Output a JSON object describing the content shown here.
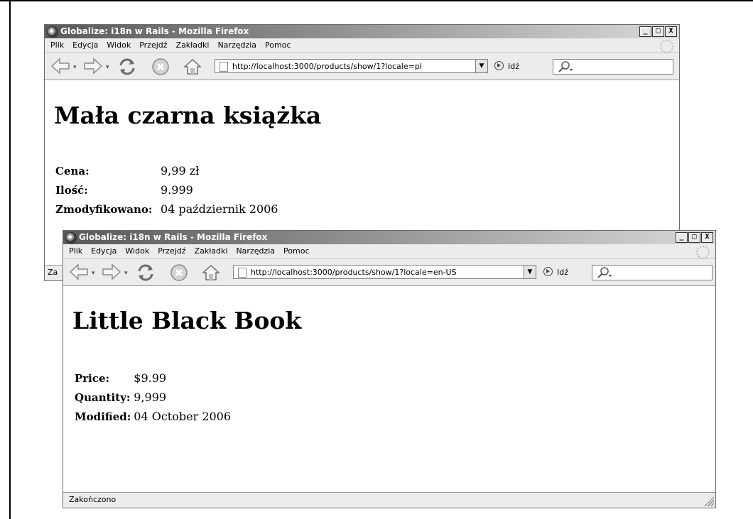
{
  "windows": {
    "back": {
      "title": "Globalize: i18n w Rails - Mozilla Firefox",
      "url": "http://localhost:3000/products/show/1?locale=pl",
      "heading": "Mała czarna książka",
      "rows": [
        {
          "label": "Cena:",
          "value": "9,99 zł"
        },
        {
          "label": "Ilość:",
          "value": "9.999"
        },
        {
          "label": "Zmodyfikowano:",
          "value": "04 październik 2006"
        }
      ],
      "status": "Za"
    },
    "front": {
      "title": "Globalize: i18n w Rails - Mozilla Firefox",
      "url": "http://localhost:3000/products/show/1?locale=en-US",
      "heading": "Little Black Book",
      "rows": [
        {
          "label": "Price:",
          "value": "$9.99"
        },
        {
          "label": "Quantity:",
          "value": "9,999"
        },
        {
          "label": "Modified:",
          "value": "04 October 2006"
        }
      ],
      "status": "Zakończono"
    }
  },
  "menu": [
    "Plik",
    "Edycja",
    "Widok",
    "Przejdź",
    "Zakładki",
    "Narzędzia",
    "Pomoc"
  ],
  "go_label": "Idź",
  "window_buttons": {
    "minimize": "_",
    "maximize": "□",
    "close": "X"
  },
  "icons": {
    "back": "back-arrow-icon",
    "forward": "forward-arrow-icon",
    "reload": "reload-icon",
    "stop": "stop-icon",
    "home": "home-icon",
    "search": "magnifier-icon"
  }
}
